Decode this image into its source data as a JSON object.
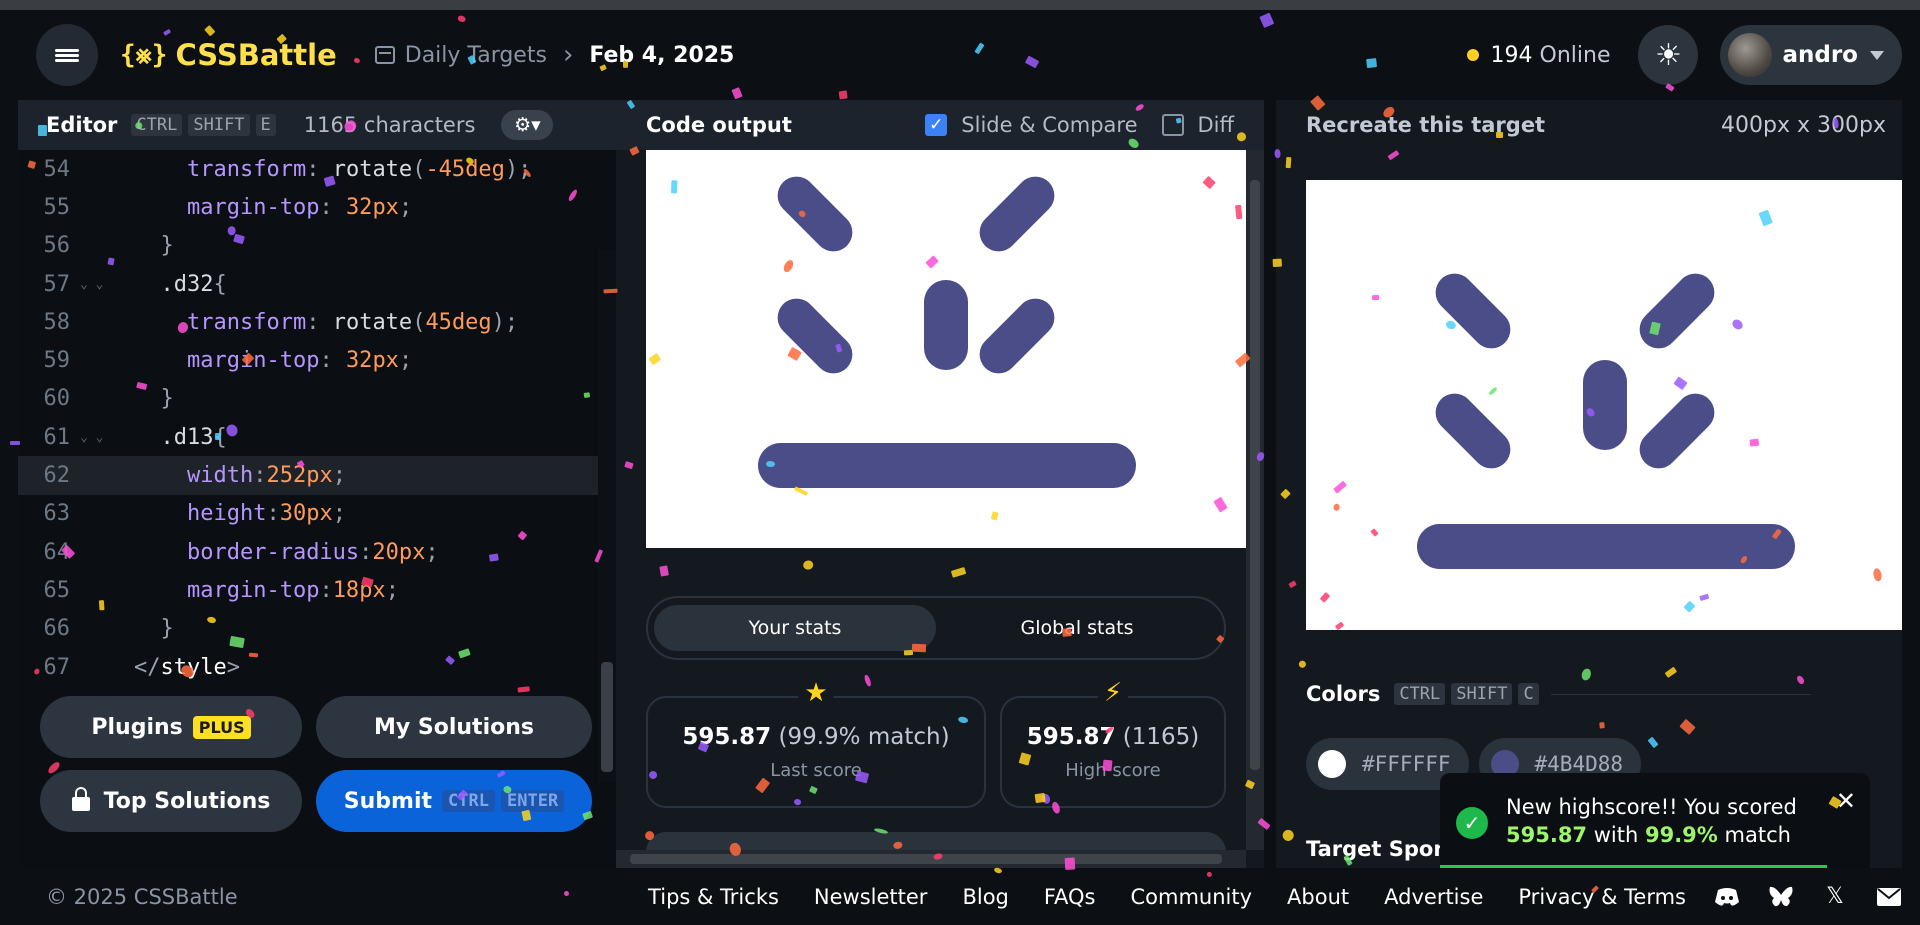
{
  "header": {
    "logo_mark": "{⨳}",
    "logo_text": "CSSBattle",
    "breadcrumb_1": "Daily Targets",
    "breadcrumb_2": "Feb 4, 2025",
    "online_count": "194",
    "online_label": "Online",
    "theme_icon": "☀",
    "username": "andro"
  },
  "editor": {
    "title": "Editor",
    "shortcut": [
      "CTRL",
      "SHIFT",
      "E"
    ],
    "characters": "1165 characters",
    "lines": [
      {
        "n": "54",
        "fold": "",
        "indent": 2,
        "tokens": [
          [
            "prop",
            "transform"
          ],
          [
            "punc",
            ": "
          ],
          [
            "func",
            "rotate"
          ],
          [
            "punc",
            "("
          ],
          [
            "num",
            "-45"
          ],
          [
            "unit",
            "deg"
          ],
          [
            "punc",
            ");"
          ]
        ]
      },
      {
        "n": "55",
        "fold": "",
        "indent": 2,
        "tokens": [
          [
            "prop",
            "margin-top"
          ],
          [
            "punc",
            ": "
          ],
          [
            "num",
            "32"
          ],
          [
            "unit",
            "px"
          ],
          [
            "punc",
            ";"
          ]
        ]
      },
      {
        "n": "56",
        "fold": "",
        "indent": 1,
        "tokens": [
          [
            "punc",
            "}"
          ]
        ]
      },
      {
        "n": "57",
        "fold": "⌄ ⌄",
        "indent": 1,
        "tokens": [
          [
            "sel",
            ".d32"
          ],
          [
            "punc",
            "{"
          ]
        ]
      },
      {
        "n": "58",
        "fold": "",
        "indent": 2,
        "tokens": [
          [
            "prop",
            "transform"
          ],
          [
            "punc",
            ": "
          ],
          [
            "func",
            "rotate"
          ],
          [
            "punc",
            "("
          ],
          [
            "num",
            "45"
          ],
          [
            "unit",
            "deg"
          ],
          [
            "punc",
            ");"
          ]
        ]
      },
      {
        "n": "59",
        "fold": "",
        "indent": 2,
        "tokens": [
          [
            "prop",
            "margin-top"
          ],
          [
            "punc",
            ": "
          ],
          [
            "num",
            "32"
          ],
          [
            "unit",
            "px"
          ],
          [
            "punc",
            ";"
          ]
        ]
      },
      {
        "n": "60",
        "fold": "",
        "indent": 1,
        "tokens": [
          [
            "punc",
            "}"
          ]
        ]
      },
      {
        "n": "61",
        "fold": "⌄ ⌄",
        "indent": 1,
        "tokens": [
          [
            "sel",
            ".d13"
          ],
          [
            "punc",
            "{"
          ]
        ]
      },
      {
        "n": "62",
        "fold": "",
        "indent": 2,
        "current": true,
        "tokens": [
          [
            "prop",
            "width"
          ],
          [
            "punc",
            ":"
          ],
          [
            "num",
            "252"
          ],
          [
            "unit",
            "px"
          ],
          [
            "punc",
            ";"
          ]
        ]
      },
      {
        "n": "63",
        "fold": "",
        "indent": 2,
        "tokens": [
          [
            "prop",
            "height"
          ],
          [
            "punc",
            ":"
          ],
          [
            "num",
            "30"
          ],
          [
            "unit",
            "px"
          ],
          [
            "punc",
            ";"
          ]
        ]
      },
      {
        "n": "64",
        "fold": "",
        "indent": 2,
        "tokens": [
          [
            "prop",
            "border-radius"
          ],
          [
            "punc",
            ":"
          ],
          [
            "num",
            "20"
          ],
          [
            "unit",
            "px"
          ],
          [
            "punc",
            ";"
          ]
        ]
      },
      {
        "n": "65",
        "fold": "",
        "indent": 2,
        "tokens": [
          [
            "prop",
            "margin-top"
          ],
          [
            "punc",
            ":"
          ],
          [
            "num",
            "18"
          ],
          [
            "unit",
            "px"
          ],
          [
            "punc",
            ";"
          ]
        ]
      },
      {
        "n": "66",
        "fold": "",
        "indent": 1,
        "tokens": [
          [
            "punc",
            "}"
          ]
        ]
      },
      {
        "n": "67",
        "fold": "",
        "indent": 0,
        "tokens": [
          [
            "punc",
            "</"
          ],
          [
            "tag",
            "style"
          ],
          [
            "punc",
            ">"
          ]
        ]
      }
    ],
    "buttons": {
      "plugins": "Plugins",
      "plus_badge": "PLUS",
      "my_solutions": "My Solutions",
      "top_solutions": "Top Solutions",
      "submit": "Submit",
      "submit_keys": [
        "CTRL",
        "ENTER"
      ]
    }
  },
  "output": {
    "title": "Code output",
    "slide_compare": "Slide & Compare",
    "slide_compare_checked": true,
    "diff": "Diff",
    "diff_checked": false,
    "tab_your_stats": "Your stats",
    "tab_global_stats": "Global stats",
    "last_score_value": "595.87",
    "last_score_match": "(99.9% match)",
    "last_score_label": "Last score",
    "high_score_value": "595.87",
    "high_score_chars": "(1165)",
    "high_score_label": "High score"
  },
  "target": {
    "title": "Recreate this target",
    "dimensions": "400px x 300px",
    "colors_title": "Colors",
    "colors_shortcut": [
      "CTRL",
      "SHIFT",
      "C"
    ],
    "colors": [
      {
        "hex": "#FFFFFF"
      },
      {
        "hex": "#4B4D88"
      }
    ],
    "sponsor_label": "Target Spon"
  },
  "toast": {
    "line1": "New highscore!! You scored",
    "score": "595.87",
    "with": "with",
    "match": "99.9%",
    "match_label": "match",
    "progress": 0.9
  },
  "footer": {
    "copyright": "© 2025 CSSBattle",
    "links": [
      "Tips & Tricks",
      "Newsletter",
      "Blog",
      "FAQs",
      "Community",
      "About",
      "Advertise",
      "Privacy & Terms"
    ]
  },
  "colors": {
    "shape": "#4B4D88",
    "accent": "#FFDF4B",
    "primary": "#0A63D9"
  }
}
